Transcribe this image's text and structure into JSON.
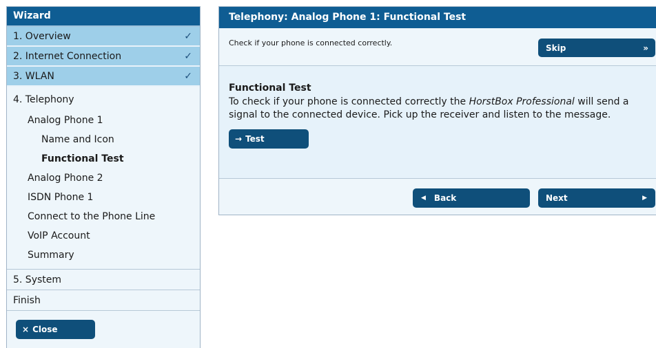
{
  "sidebar": {
    "title": "Wizard",
    "done_steps": [
      {
        "label": "1. Overview",
        "check": "✓"
      },
      {
        "label": "2. Internet Connection",
        "check": "✓"
      },
      {
        "label": "3. WLAN",
        "check": "✓"
      }
    ],
    "current_step": {
      "label": "4. Telephony",
      "analog_phone_1": "Analog Phone 1",
      "name_and_icon": "Name and Icon",
      "functional_test": "Functional Test",
      "analog_phone_2": "Analog Phone 2",
      "isdn_phone_1": "ISDN Phone 1",
      "connect_phone_line": "Connect to the Phone Line",
      "voip_account": "VoIP Account",
      "summary": "Summary"
    },
    "system": "5. System",
    "finish": "Finish",
    "close_label": "Close",
    "close_icon": "×"
  },
  "panel": {
    "title": "Telephony: Analog Phone 1: Functional Test",
    "hint": "Check if your phone is connected correctly.",
    "skip_label": "Skip",
    "skip_icon": "»",
    "heading": "Functional Test",
    "text_before": "To check if your phone is connected correctly the ",
    "product": "HorstBox Professional",
    "text_after": " will send a signal to the connected device. Pick up the receiver and listen to the message.",
    "test_label": "Test",
    "test_icon": "→",
    "back_label": "Back",
    "back_icon": "◀",
    "next_label": "Next",
    "next_icon": "▶"
  }
}
